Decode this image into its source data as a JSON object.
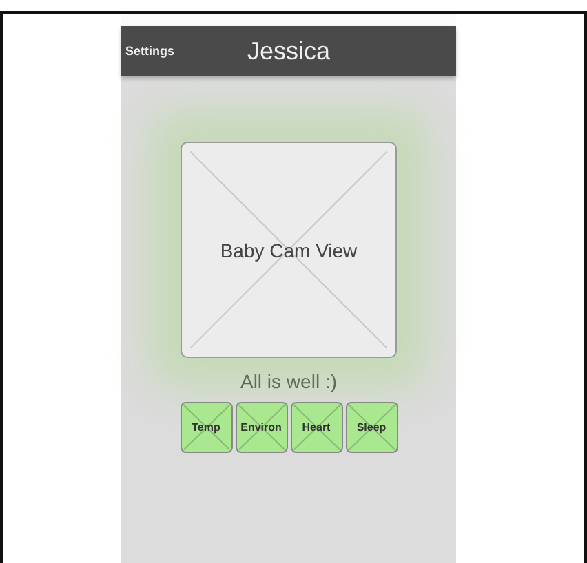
{
  "nav_bar": {
    "back_button": "Settings",
    "title": "Jessica"
  },
  "cam_view": {
    "label": "Baby Cam View"
  },
  "status_message": "All is well :)",
  "sensor_buttons": [
    {
      "label": "Temp"
    },
    {
      "label": "Environ"
    },
    {
      "label": "Heart"
    },
    {
      "label": "Sleep"
    }
  ]
}
